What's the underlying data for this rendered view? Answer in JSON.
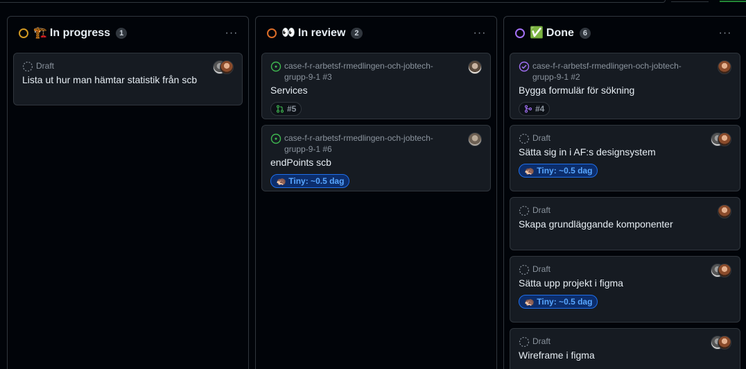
{
  "colors": {
    "in_progress": "#d29922",
    "in_review": "#db6d28",
    "done": "#a371f7",
    "open_issue": "#3fb950",
    "closed_issue": "#a371f7",
    "size_pill": "#58a6ff"
  },
  "columns": [
    {
      "title": "In progress",
      "emoji": "🏗️",
      "count": "1",
      "menu": "···",
      "cards": [
        {
          "meta": "Draft",
          "title": "Lista ut hur man hämtar statistik från scb"
        }
      ]
    },
    {
      "title": "In review",
      "emoji": "👀",
      "count": "2",
      "menu": "···",
      "cards": [
        {
          "meta": "case-f-r-arbetsf-rmedlingen-och-jobtech-grupp-9-1 #3",
          "title": "Services",
          "pill": "#5"
        },
        {
          "meta": "case-f-r-arbetsf-rmedlingen-och-jobtech-grupp-9-1 #6",
          "title": "endPoints scb",
          "pill": "🦔 Tiny: ~0.5 dag"
        }
      ]
    },
    {
      "title": "Done",
      "emoji": "✅",
      "count": "6",
      "menu": "···",
      "cards": [
        {
          "meta": "case-f-r-arbetsf-rmedlingen-och-jobtech-grupp-9-1 #2",
          "title": "Bygga formulär för sökning",
          "pill": "#4"
        },
        {
          "meta": "Draft",
          "title": "Sätta sig in i AF:s designsystem",
          "pill": "🦔 Tiny: ~0.5 dag"
        },
        {
          "meta": "Draft",
          "title": "Skapa grundläggande komponenter"
        },
        {
          "meta": "Draft",
          "title": "Sätta upp projekt i figma",
          "pill": "🦔 Tiny: ~0.5 dag"
        },
        {
          "meta": "Draft",
          "title": "Wireframe i figma"
        }
      ]
    }
  ]
}
